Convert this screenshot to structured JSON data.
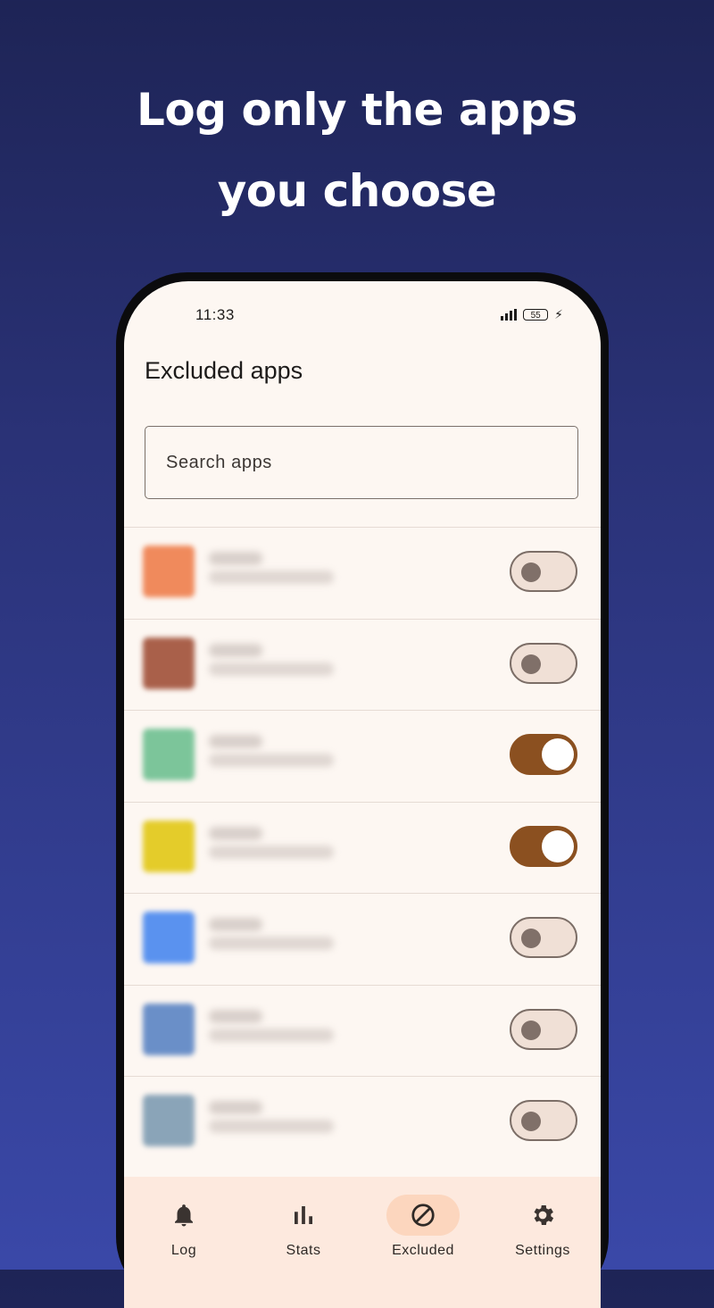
{
  "headline": {
    "line1": "Log only the apps",
    "line2": "you choose"
  },
  "status_bar": {
    "time": "11:33",
    "battery": "55"
  },
  "page": {
    "title": "Excluded apps"
  },
  "search": {
    "placeholder": "Search apps"
  },
  "apps": [
    {
      "icon_color": "#f08a5c",
      "excluded": false
    },
    {
      "icon_color": "#a9604a",
      "excluded": false
    },
    {
      "icon_color": "#7cc59a",
      "excluded": true
    },
    {
      "icon_color": "#e4cc2a",
      "excluded": true
    },
    {
      "icon_color": "#5a92ef",
      "excluded": false
    },
    {
      "icon_color": "#6a8fc8",
      "excluded": false
    },
    {
      "icon_color": "#8aa4b8",
      "excluded": false
    }
  ],
  "nav": {
    "items": [
      {
        "label": "Log",
        "icon": "bell-icon"
      },
      {
        "label": "Stats",
        "icon": "bar-chart-icon"
      },
      {
        "label": "Excluded",
        "icon": "block-icon",
        "active": true
      },
      {
        "label": "Settings",
        "icon": "gear-icon"
      }
    ]
  },
  "colors": {
    "accent": "#8b5020",
    "background": "#fdf7f2",
    "nav_background": "#fde9de",
    "active_pill": "#fcd6be"
  }
}
